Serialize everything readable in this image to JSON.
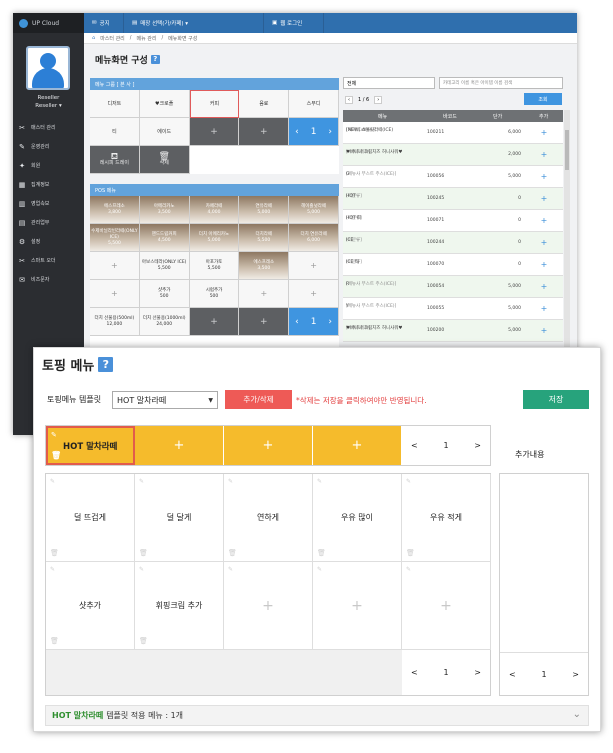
{
  "back": {
    "app_name": "UP Cloud",
    "user": {
      "name": "Reseller",
      "role": "Reseller ▾"
    },
    "sidebar": [
      "매스터 관리",
      "운영관리",
      "회원",
      "집계정보",
      "영업속보",
      "관리업무",
      "설정",
      "스마트 오더",
      "비즈문자"
    ],
    "topbar": {
      "home": "공지",
      "store": "매장 선택(가/카페) ▾",
      "logout": "웹 로그인"
    },
    "breadcrumb": [
      "⌂",
      "마스터 관리",
      "메뉴 관리",
      "메뉴화면 구성"
    ],
    "title": "메뉴화면 구성",
    "menu_group": {
      "header": "메뉴 그룹 [ 본 사 ]",
      "row1": [
        "디저트",
        "♥크로플",
        "커피",
        "음료",
        "스무디"
      ],
      "row2": [
        "티",
        "에이드"
      ],
      "page": "1",
      "actions": [
        "레시피 드레이",
        "삭제"
      ]
    },
    "pos_menu": {
      "header": "POS 메뉴",
      "row1": [
        {
          "name": "에스프레소",
          "price": "3,800"
        },
        {
          "name": "아메리카노",
          "price": "3,500"
        },
        {
          "name": "카페라떼",
          "price": "4,000"
        },
        {
          "name": "연유라떼",
          "price": "5,000"
        },
        {
          "name": "헤이즐넛라떼",
          "price": "5,000"
        }
      ],
      "row2": [
        {
          "name": "수제바닐라빈라떼(ONLY ICE)",
          "price": "5,500"
        },
        {
          "name": "핸드드립커피",
          "price": "4,500"
        },
        {
          "name": "더치 아메리카노",
          "price": "5,000"
        },
        {
          "name": "더치라떼",
          "price": "5,500"
        },
        {
          "name": "더치 연유라떼",
          "price": "6,000"
        }
      ],
      "row3": [
        {
          "name": "",
          "price": ""
        },
        {
          "name": "아보스테라(ONLY ICE)",
          "price": "5,500"
        },
        {
          "name": "아포가토",
          "price": "5,500"
        },
        {
          "name": "에스프레소",
          "price": "3,500"
        },
        {
          "name": "",
          "price": ""
        }
      ],
      "row4": [
        {
          "name": "",
          "price": ""
        },
        {
          "name": "샷추가",
          "price": "500"
        },
        {
          "name": "시럽추가",
          "price": "500"
        },
        {
          "name": "",
          "price": ""
        },
        {
          "name": "",
          "price": ""
        }
      ],
      "row5": [
        {
          "name": "더치 선물용(500ml)",
          "price": "12,000"
        },
        {
          "name": "더치 선물용(1000ml)",
          "price": "24,000"
        }
      ],
      "page": "1"
    },
    "filter": {
      "select": "전체",
      "search_placeholder": "카테고리 이름 혹은 아이템 이름 검색",
      "pager": "1 / 6",
      "search_btn": "조회"
    },
    "table": {
      "headers": [
        "메뉴",
        "바코드",
        "단가",
        "추가"
      ],
      "rows": [
        {
          "cat": "[커피(Coffee)]",
          "name": "[NEW] 쇼콜릿라떼(ICE)",
          "code": "100211",
          "price": "6,000"
        },
        {
          "cat": "[사이드메뉴]",
          "name": "♥바나나 크림치즈 허니사워♥",
          "code": "",
          "price": "2,000"
        },
        {
          "cat": "[메뉴사 부스트 주스(ICE)]",
          "name": "G",
          "code": "100056",
          "price": "5,000"
        },
        {
          "cat": "[미분류]",
          "name": "HOT",
          "code": "100245",
          "price": "0"
        },
        {
          "cat": "[미분류]",
          "name": "HOT 티",
          "code": "100071",
          "price": "0"
        },
        {
          "cat": "[미분류]",
          "name": "ICE",
          "code": "100244",
          "price": "0"
        },
        {
          "cat": "[미분류]",
          "name": "ICE 티",
          "code": "100070",
          "price": "0"
        },
        {
          "cat": "[메뉴사 부스트 주스(ICE)]",
          "name": "R",
          "code": "100054",
          "price": "5,000"
        },
        {
          "cat": "[메뉴사 부스트 주스(ICE)]",
          "name": "Y",
          "code": "100055",
          "price": "5,000"
        },
        {
          "cat": "[사이드메뉴]",
          "name": "♥바나나 크림치즈 허니사워♥",
          "code": "100200",
          "price": "5,000"
        }
      ],
      "add_icon": "+"
    }
  },
  "front": {
    "title": "토핑 메뉴",
    "template_label": "토핑메뉴 템플릿",
    "template_value": "HOT 말차라떼",
    "add_delete_btn": "추가/삭제",
    "note": "*삭제는 저장을 클릭하여야만 반영됩니다.",
    "save_btn": "저장",
    "selected_template": "HOT 말차라떼",
    "template_page": "1",
    "add_content_label": "추가내용",
    "toppings_row1": [
      "덜 뜨겁게",
      "덜 달게",
      "연하게",
      "우유 많이",
      "우유 적게"
    ],
    "toppings_row2": [
      "샷추가",
      "휘핑크림 추가"
    ],
    "grid_page": "1",
    "add_page": "1",
    "footer_name": "HOT 말차라떼",
    "footer_text": "템플릿 적용 메뉴 : 1개",
    "pager_prev": "<",
    "pager_next": ">",
    "plus": "+"
  }
}
